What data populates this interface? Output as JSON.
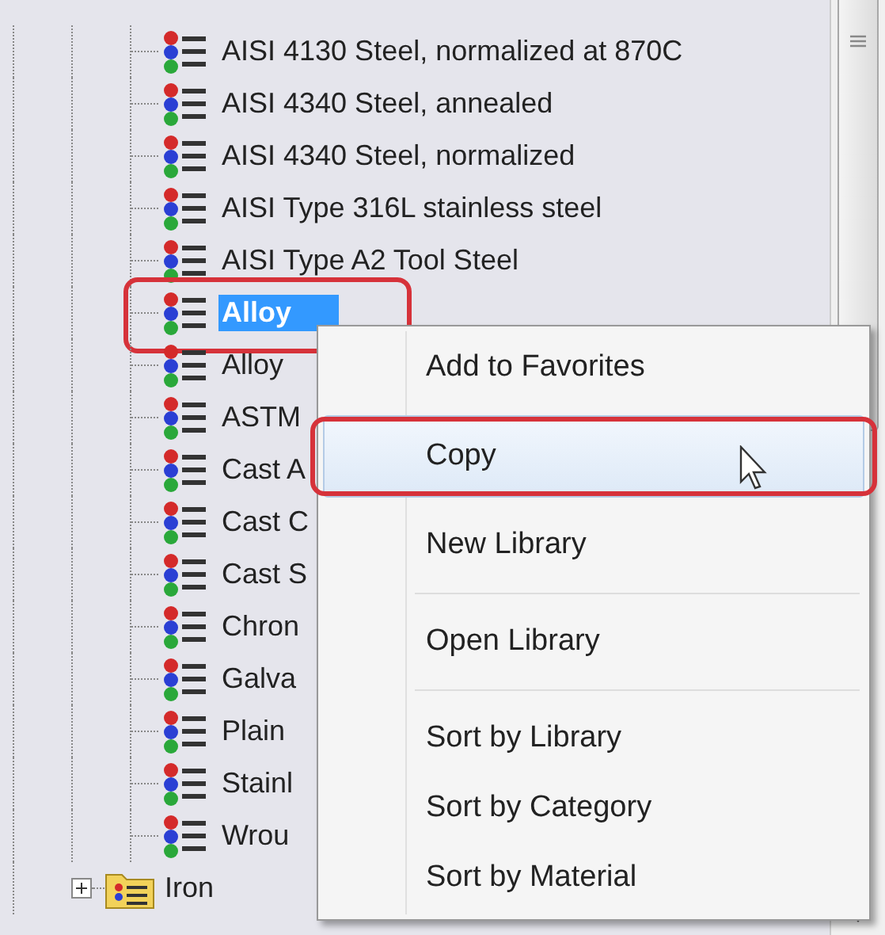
{
  "materials": [
    {
      "label": "AISI 4130 Steel, normalized at 870C",
      "selected": false,
      "outlined": false
    },
    {
      "label": "AISI 4340 Steel, annealed",
      "selected": false,
      "outlined": false
    },
    {
      "label": "AISI 4340 Steel, normalized",
      "selected": false,
      "outlined": false
    },
    {
      "label": "AISI Type 316L stainless steel",
      "selected": false,
      "outlined": false
    },
    {
      "label": "AISI Type A2 Tool Steel",
      "selected": false,
      "outlined": false
    },
    {
      "label": "Alloy",
      "selected": true,
      "outlined": true
    },
    {
      "label": "Alloy",
      "selected": false,
      "outlined": false
    },
    {
      "label": "ASTM",
      "selected": false,
      "outlined": false
    },
    {
      "label": "Cast A",
      "selected": false,
      "outlined": false
    },
    {
      "label": "Cast C",
      "selected": false,
      "outlined": false
    },
    {
      "label": "Cast S",
      "selected": false,
      "outlined": false
    },
    {
      "label": "Chron",
      "selected": false,
      "outlined": false
    },
    {
      "label": "Galva",
      "selected": false,
      "outlined": false
    },
    {
      "label": "Plain",
      "selected": false,
      "outlined": false
    },
    {
      "label": "Stainl",
      "selected": false,
      "outlined": false
    },
    {
      "label": "Wrou",
      "selected": false,
      "outlined": false
    }
  ],
  "folders": [
    {
      "label": "Iron",
      "expanded": false
    }
  ],
  "context_menu": {
    "groups": [
      [
        {
          "label": "Add to Favorites",
          "highlighted": false,
          "outlined": false
        },
        {
          "label": "Copy",
          "highlighted": true,
          "outlined": true
        },
        {
          "label": "New Library",
          "highlighted": false,
          "outlined": false
        }
      ],
      [
        {
          "label": "Open Library",
          "highlighted": false,
          "outlined": false
        }
      ],
      [
        {
          "label": "Sort by Library",
          "highlighted": false,
          "outlined": false
        },
        {
          "label": "Sort by Category",
          "highlighted": false,
          "outlined": false
        },
        {
          "label": "Sort by Material",
          "highlighted": false,
          "outlined": false
        }
      ]
    ]
  }
}
